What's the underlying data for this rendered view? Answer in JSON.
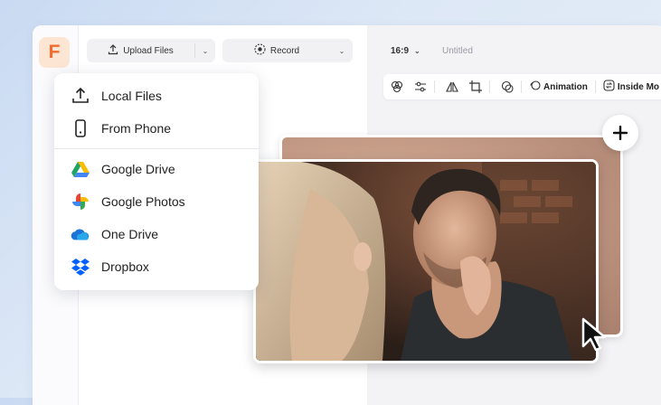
{
  "toolbar": {
    "upload_label": "Upload Files",
    "record_label": "Record"
  },
  "canvas_header": {
    "ratio": "16:9",
    "title": "Untitled"
  },
  "edit_toolbar": {
    "animation_label": "Animation",
    "inside_label": "Inside Mo"
  },
  "upload_menu": {
    "items": [
      {
        "label": "Local Files",
        "icon": "upload-icon"
      },
      {
        "label": "From Phone",
        "icon": "phone-icon"
      },
      {
        "label": "Google Drive",
        "icon": "google-drive-icon"
      },
      {
        "label": "Google Photos",
        "icon": "google-photos-icon"
      },
      {
        "label": "One Drive",
        "icon": "onedrive-icon"
      },
      {
        "label": "Dropbox",
        "icon": "dropbox-icon"
      }
    ]
  },
  "brand": {
    "logo_letter": "F",
    "accent": "#f26a2e"
  }
}
